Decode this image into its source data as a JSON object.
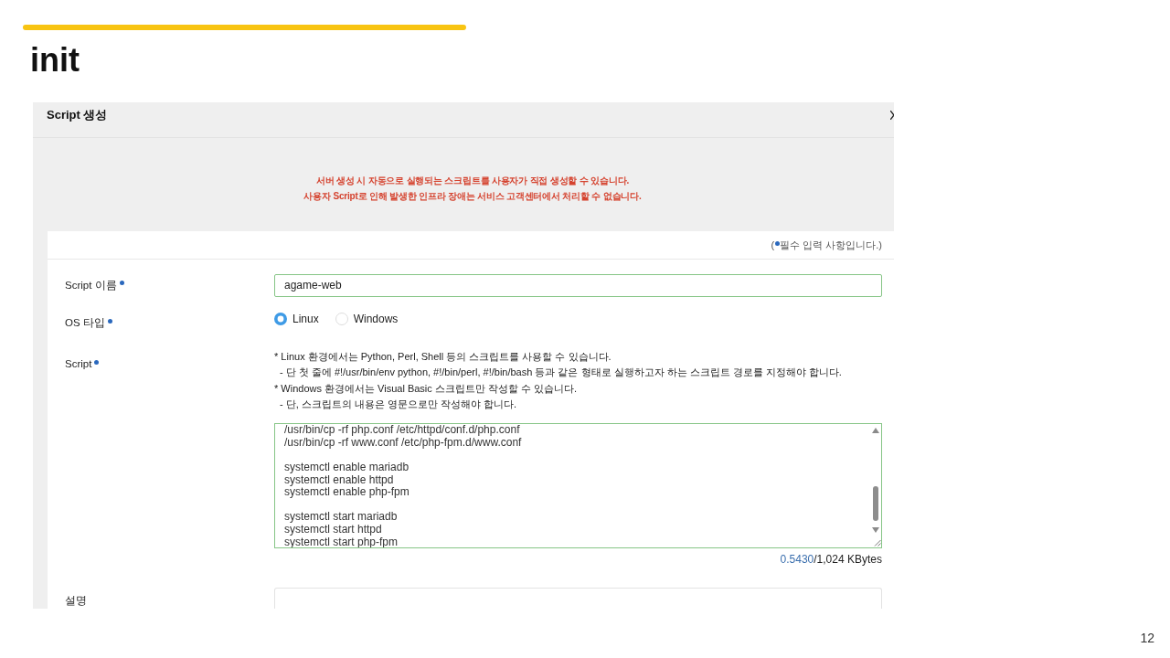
{
  "slide": {
    "title": "init",
    "page_number": "12"
  },
  "dialog": {
    "title": "Script 생성",
    "notice": [
      "서버 생성 시 자동으로 실행되는 스크립트를 사용자가 직접 생성할 수 있습니다.",
      "사용자 Script로 인해 발생한 인프라 장애는 서비스 고객센터에서 처리할 수 없습니다."
    ],
    "legend": {
      "before": "(",
      "text": "필수 입력 사항입니다.)"
    },
    "fields": [
      {
        "kind": "text",
        "label": "Script 이름",
        "required": true,
        "valid": true,
        "value": "agame-web"
      },
      {
        "kind": "radio",
        "label": "OS 타입",
        "required": true,
        "options": [
          {
            "label": "Linux",
            "selected": true
          },
          {
            "label": "Windows",
            "selected": false
          }
        ]
      },
      {
        "kind": "script",
        "label": "Script",
        "required": true,
        "valid": true,
        "help": [
          {
            "text": "* Linux 환경에서는 Python, Perl, Shell 등의 스크립트를 사용할 수 있습니다.",
            "children": [
              {
                "text": "- 단 첫 줄에 #!/usr/bin/env python, #!/bin/perl, #!/bin/bash 등과 같은 형태로 실행하고자 하는 스크립트 경로를 지정해야 합니다."
              }
            ]
          },
          {
            "text": "* Windows 환경에서는 Visual Basic 스크립트만 작성할 수 있습니다.",
            "children": [
              {
                "text": "- 단, 스크립트의 내용은 영문으로만 작성해야 합니다."
              }
            ]
          }
        ],
        "content": "/usr/bin/cp -rf php.conf /etc/httpd/conf.d/php.conf\n/usr/bin/cp -rf www.conf /etc/php-fpm.d/www.conf\n\nsystemctl enable mariadb\nsystemctl enable httpd\nsystemctl enable php-fpm\n\nsystemctl start mariadb\nsystemctl start httpd\nsystemctl start php-fpm",
        "size_used": "0.5430",
        "size_limit": "/1,024 KBytes"
      },
      {
        "kind": "textarea",
        "label": "설명",
        "required": false,
        "valid": false
      }
    ]
  }
}
